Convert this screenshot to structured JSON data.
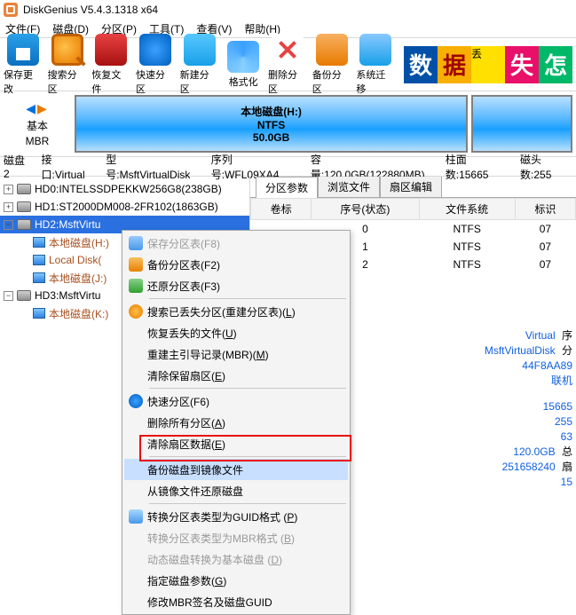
{
  "title": "DiskGenius V5.4.3.1318 x64",
  "menu": {
    "file": "文件(F)",
    "disk": "磁盘(D)",
    "part": "分区(P)",
    "tools": "工具(T)",
    "view": "查看(V)",
    "help": "帮助(H)"
  },
  "toolbar": {
    "save": "保存更改",
    "search": "搜索分区",
    "recover": "恢复文件",
    "quick": "快速分区",
    "newp": "新建分区",
    "format": "格式化",
    "delete": "删除分区",
    "backup": "备份分区",
    "migrate": "系统迁移"
  },
  "banner": {
    "a": "数",
    "b": "据",
    "c": "丢",
    "d": "失",
    "e": "怎"
  },
  "basic": {
    "label1": "基本",
    "label2": "MBR"
  },
  "vol": {
    "name": "本地磁盘(H:)",
    "fs": "NTFS",
    "size": "50.0GB"
  },
  "diskinfo": {
    "d1": "磁盘2",
    "d2": "接口:Virtual",
    "d3": "型号:MsftVirtualDisk",
    "d4": "序列号:WFL09XA4",
    "d5": "容量:120.0GB(122880MB)",
    "d6": "柱面数:15665",
    "d7": "磁头数:255"
  },
  "tree": {
    "hd0": "HD0:INTELSSDPEKKW256G8(238GB)",
    "hd1": "HD1:ST2000DM008-2FR102(1863GB)",
    "hd2": "HD2:MsftVirtu",
    "hd2a": "本地磁盘(H:)",
    "hd2b": "Local Disk(",
    "hd2c": "本地磁盘(J:)",
    "hd3": "HD3:MsftVirtu",
    "hd3a": "本地磁盘(K:)"
  },
  "tabs": {
    "params": "分区参数",
    "browse": "浏览文件",
    "sector": "扇区编辑"
  },
  "grid": {
    "h1": "卷标",
    "h2": "序号(状态)",
    "h3": "文件系统",
    "h4": "标识",
    "rows": [
      {
        "c1": "",
        "c2": "0",
        "c3": "NTFS",
        "c4": "07"
      },
      {
        "c1": "",
        "c2": "1",
        "c3": "NTFS",
        "c4": "07"
      },
      {
        "c1": "",
        "c2": "2",
        "c3": "NTFS",
        "c4": "07"
      }
    ]
  },
  "side": {
    "l0a": "Virtual",
    "l0b": "序",
    "l1a": "MsftVirtualDisk",
    "l1b": "分",
    "l2a": "44F8AA89",
    "l3a": "联机",
    "l4a": "15665",
    "l5a": "255",
    "l6a": "63",
    "l7a": "120.0GB",
    "l7b": "总",
    "l8a": "251658240",
    "l8b": "扇",
    "l9a": "15"
  },
  "ctx": {
    "i1": "保存分区表(F8)",
    "i2": "备份分区表(F2)",
    "i3": "还原分区表(F3)",
    "i4": "搜索已丢失分区(重建分区表)(",
    "i4u": "L",
    "i4e": ")",
    "i5": "恢复丢失的文件(",
    "i5u": "U",
    "i5e": ")",
    "i6": "重建主引导记录(MBR)(",
    "i6u": "M",
    "i6e": ")",
    "i7": "清除保留扇区(",
    "i7u": "E",
    "i7e": ")",
    "i8": "快速分区(F6)",
    "i9": "删除所有分区(",
    "i9u": "A",
    "i9e": ")",
    "i10": "清除扇区数据(",
    "i10u": "E",
    "i10e": ")",
    "i11": "备份磁盘到镜像文件",
    "i12": "从镜像文件还原磁盘",
    "i13": "转换分区表类型为GUID格式 (",
    "i13u": "P",
    "i13e": ")",
    "i14": "转换分区表类型为MBR格式 (",
    "i14u": "B",
    "i14e": ")",
    "i15": "动态磁盘转换为基本磁盘 (",
    "i15u": "D",
    "i15e": ")",
    "i16": "指定磁盘参数(",
    "i16u": "G",
    "i16e": ")",
    "i17": "修改MBR签名及磁盘GUID"
  }
}
